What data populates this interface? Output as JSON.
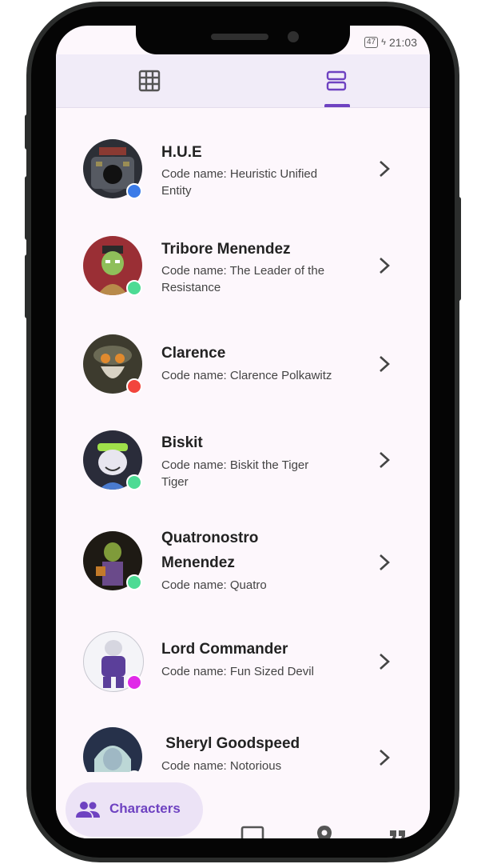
{
  "status_bar": {
    "battery": "47",
    "time": "21:03"
  },
  "tabs": [
    {
      "icon": "grid-icon",
      "selected": false
    },
    {
      "icon": "list-view-icon",
      "selected": true
    }
  ],
  "characters": [
    {
      "name": "H.U.E",
      "code_line1": "Code name: Heuristic Unified",
      "code_line2": "Entity",
      "status_color": "#3b7be8"
    },
    {
      "name": "Tribore Menendez",
      "code_line1": "Code name: The Leader  of the",
      "code_line2": "Resistance",
      "status_color": "#4cdb94"
    },
    {
      "name": "Clarence",
      "code_line1": "Code name: Clarence Polkawitz",
      "code_line2": "",
      "status_color": "#f2453d"
    },
    {
      "name": "Biskit",
      "code_line1": "Code name: Biskit the Tiger",
      "code_line2": "Tiger",
      "status_color": "#4cdb94"
    },
    {
      "name_line1": "Quatronostro",
      "name_line2": "Menendez",
      "code_line1": "Code name: Quatro",
      "status_color": "#4cdb94"
    },
    {
      "name": "Lord Commander",
      "code_line1": "Code name: Fun Sized Devil",
      "code_line2": "",
      "status_color": "#e02ae8"
    },
    {
      "name": " Sheryl Goodspeed",
      "code_line1": "Code name: Notorious",
      "code_line2": "",
      "status_color": "#4cdb94"
    }
  ],
  "bottom_nav": {
    "characters_label": "Characters",
    "items": [
      "characters-icon",
      "tv-icon",
      "location-pin-icon",
      "quote-icon"
    ],
    "accent_color": "#6e42c1"
  }
}
